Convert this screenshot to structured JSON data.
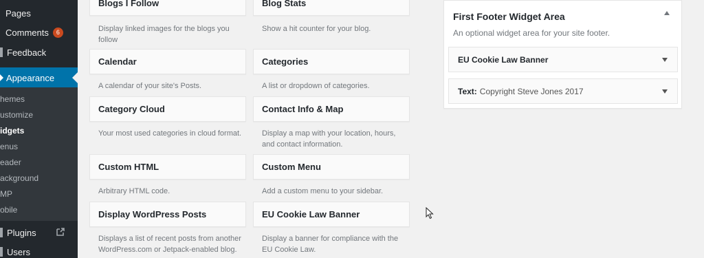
{
  "sidebar": {
    "pages": "Pages",
    "comments": "Comments",
    "comments_count": "6",
    "feedback": "Feedback",
    "appearance": "Appearance",
    "sub": [
      "hemes",
      "ustomize",
      "idgets",
      "enus",
      "eader",
      "ackground",
      "MP",
      "obile"
    ],
    "plugins": "Plugins",
    "users": "Users"
  },
  "widgets": [
    {
      "title": "Blogs I Follow",
      "desc": "Display linked images for the blogs you follow"
    },
    {
      "title": "Blog Stats",
      "desc": "Show a hit counter for your blog."
    },
    {
      "title": "Calendar",
      "desc": "A calendar of your site's Posts."
    },
    {
      "title": "Categories",
      "desc": "A list or dropdown of categories."
    },
    {
      "title": "Category Cloud",
      "desc": "Your most used categories in cloud format."
    },
    {
      "title": "Contact Info & Map",
      "desc": "Display a map with your location, hours, and contact information."
    },
    {
      "title": "Custom HTML",
      "desc": "Arbitrary HTML code."
    },
    {
      "title": "Custom Menu",
      "desc": "Add a custom menu to your sidebar."
    },
    {
      "title": "Display WordPress Posts",
      "desc": "Displays a list of recent posts from another WordPress.com or Jetpack-enabled blog."
    },
    {
      "title": "EU Cookie Law Banner",
      "desc": "Display a banner for compliance with the EU Cookie Law."
    }
  ],
  "footer_area": {
    "title": "First Footer Widget Area",
    "desc": "An optional widget area for your site footer.",
    "items": [
      {
        "title": "EU Cookie Law Banner",
        "in_title": ""
      },
      {
        "title": "Text:",
        "in_title": "Copyright Steve Jones 2017"
      }
    ]
  },
  "colors": {
    "admin_bar": "#23282d",
    "accent": "#0073aa",
    "badge": "#ca4a1f"
  }
}
